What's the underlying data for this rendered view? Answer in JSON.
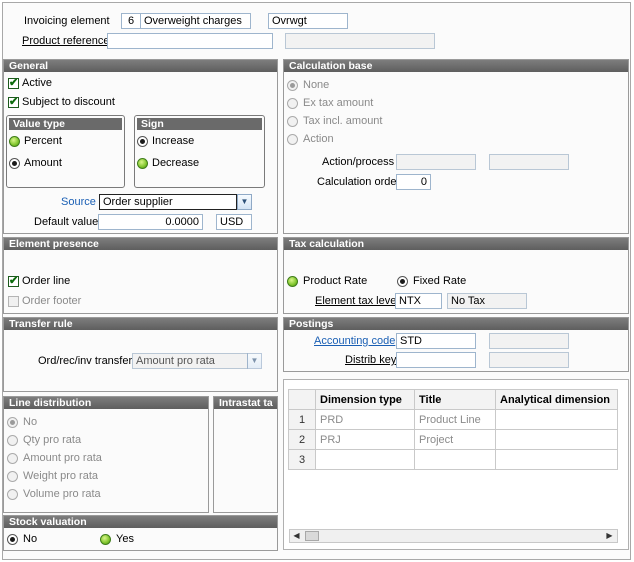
{
  "header": {
    "invoicing_element_label": "Invoicing element",
    "code": "6",
    "description": "Overweight charges",
    "short_title": "Ovrwgt",
    "product_reference_label": "Product reference",
    "product_reference_value": "",
    "product_reference_desc": ""
  },
  "general": {
    "title": "General",
    "active_label": "Active",
    "subject_discount_label": "Subject to discount",
    "value_type": {
      "title": "Value type",
      "percent": "Percent",
      "amount": "Amount",
      "selected": "Amount"
    },
    "sign": {
      "title": "Sign",
      "increase": "Increase",
      "decrease": "Decrease",
      "selected": "Increase"
    },
    "source_label": "Source",
    "source_value": "Order supplier",
    "default_value_label": "Default value",
    "default_value": "0.0000",
    "currency": "USD"
  },
  "calculation_base": {
    "title": "Calculation base",
    "options": [
      "None",
      "Ex tax amount",
      "Tax incl. amount",
      "Action"
    ],
    "selected": "None",
    "action_process_label": "Action/process",
    "calc_order_label": "Calculation order",
    "calc_order_value": "0"
  },
  "element_presence": {
    "title": "Element presence",
    "order_line": "Order line",
    "order_footer": "Order footer"
  },
  "tax_calculation": {
    "title": "Tax calculation",
    "product_rate": "Product Rate",
    "fixed_rate": "Fixed Rate",
    "selected": "Fixed Rate",
    "element_tax_level_label": "Element tax level",
    "tax_level_code": "NTX",
    "tax_level_desc": "No Tax"
  },
  "transfer_rule": {
    "title": "Transfer rule",
    "label": "Ord/rec/inv transfer",
    "value": "Amount pro rata"
  },
  "postings": {
    "title": "Postings",
    "accounting_code_label": "Accounting code",
    "accounting_code": "STD",
    "distrib_key_label": "Distrib key",
    "distrib_key": ""
  },
  "line_distribution": {
    "title": "Line distribution",
    "options": [
      "No",
      "Qty pro rata",
      "Amount pro rata",
      "Weight pro rata",
      "Volume pro rata"
    ],
    "selected": "No"
  },
  "intrastat": {
    "title": "Intrastat ta"
  },
  "stock_valuation": {
    "title": "Stock valuation",
    "no": "No",
    "yes": "Yes",
    "selected": "No"
  },
  "dimensions_grid": {
    "columns": [
      "Dimension type",
      "Title",
      "Analytical dimension"
    ],
    "rows": [
      {
        "num": "1",
        "type": "PRD",
        "title": "Product Line",
        "dimension": ""
      },
      {
        "num": "2",
        "type": "PRJ",
        "title": "Project",
        "dimension": ""
      },
      {
        "num": "3",
        "type": "",
        "title": "",
        "dimension": ""
      }
    ]
  },
  "colors": {
    "panel_header": "#6a6a6a",
    "link": "#1a5fb4",
    "field_border": "#9eb5cd"
  },
  "icons": {
    "check": "check-icon",
    "combo": "chevron-down-icon",
    "scroll_left": "arrow-left-icon",
    "scroll_right": "arrow-right-icon"
  }
}
